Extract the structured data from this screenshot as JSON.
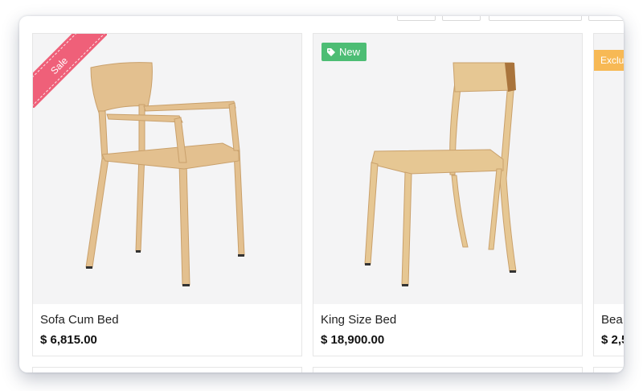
{
  "products": [
    {
      "title": "Sofa Cum Bed",
      "price": "$ 6,815.00",
      "badge": "Sale",
      "badge_style": "ribbon",
      "badge_color": "#ef6079"
    },
    {
      "title": "King Size Bed",
      "price": "$ 18,900.00",
      "badge": "New",
      "badge_icon": "tag-icon",
      "badge_style": "label",
      "badge_color": "#4dbd74"
    },
    {
      "title": "Bea",
      "price": "$ 2,5",
      "badge": "Exclus",
      "badge_style": "flag",
      "badge_color": "#f7b955"
    }
  ],
  "colors": {
    "card_image_bg": "#f4f4f5",
    "card_border": "#e6e6e6",
    "wood": "#e3c08f"
  }
}
